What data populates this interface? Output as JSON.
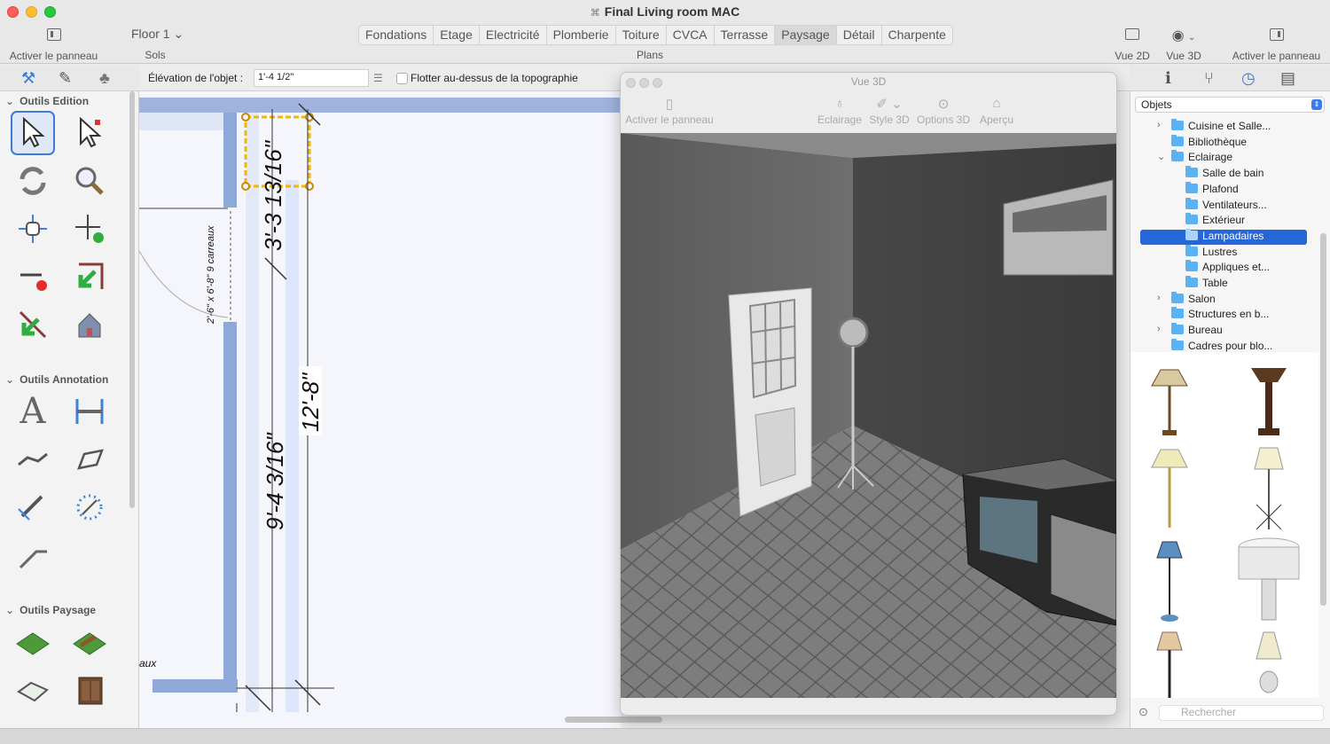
{
  "window": {
    "title": "Final Living room MAC"
  },
  "toolbar": {
    "left_panel_label": "Activer le panneau",
    "floor_value": "Floor 1",
    "floor_group_label": "Sols",
    "plans_group_label": "Plans",
    "plan_tabs": [
      "Fondations",
      "Etage",
      "Electricité",
      "Plomberie",
      "Toiture",
      "CVCA",
      "Terrasse",
      "Paysage",
      "Détail",
      "Charpente"
    ],
    "active_plan_tab": "Paysage",
    "view2d_label": "Vue 2D",
    "view3d_label": "Vue 3D",
    "right_panel_label": "Activer le panneau"
  },
  "options_bar": {
    "elevation_label": "Élévation de l'objet :",
    "elevation_value": "1'-4 1/2\"",
    "float_label": "Flotter au-dessus de la topographie",
    "float_checked": false
  },
  "left_panel": {
    "sections": [
      "Outils Edition",
      "Outils Annotation",
      "Outils Paysage"
    ]
  },
  "plan": {
    "dim_top": "3'-3 13/16\"",
    "dim_bottom": "9'-4 3/16\"",
    "dim_total": "12'-8\"",
    "door_label": "2'-6\" x 6'-8\" 9 carreaux",
    "partial_label": "aux"
  },
  "view3d": {
    "title": "Vue 3D",
    "toolbar": {
      "panel_label": "Activer le panneau",
      "lighting_label": "Eclairage",
      "style_label": "Style 3D",
      "options_label": "Options 3D",
      "preview_label": "Aperçu"
    }
  },
  "library": {
    "category": "Objets",
    "tree": [
      {
        "label": "Cuisine et Salle...",
        "level": 0,
        "expandable": true,
        "expanded": false
      },
      {
        "label": "Bibliothèque",
        "level": 0,
        "expandable": false
      },
      {
        "label": "Eclairage",
        "level": 0,
        "expandable": true,
        "expanded": true
      },
      {
        "label": "Salle de bain",
        "level": 1
      },
      {
        "label": "Plafond",
        "level": 1
      },
      {
        "label": "Ventilateurs...",
        "level": 1
      },
      {
        "label": "Extérieur",
        "level": 1
      },
      {
        "label": "Lampadaires",
        "level": 1,
        "selected": true
      },
      {
        "label": "Lustres",
        "level": 1
      },
      {
        "label": "Appliques et...",
        "level": 1
      },
      {
        "label": "Table",
        "level": 1
      },
      {
        "label": "Salon",
        "level": 0,
        "expandable": true,
        "expanded": false
      },
      {
        "label": "Structures en b...",
        "level": 0,
        "expandable": false
      },
      {
        "label": "Bureau",
        "level": 0,
        "expandable": true,
        "expanded": false
      },
      {
        "label": "Cadres pour blo...",
        "level": 0,
        "expandable": false
      }
    ],
    "search_placeholder": "Rechercher"
  },
  "colors": {
    "accent": "#2566d8",
    "wall": "#8ea8d8",
    "selection": "#f0b800",
    "folder": "#5bb2f2"
  }
}
